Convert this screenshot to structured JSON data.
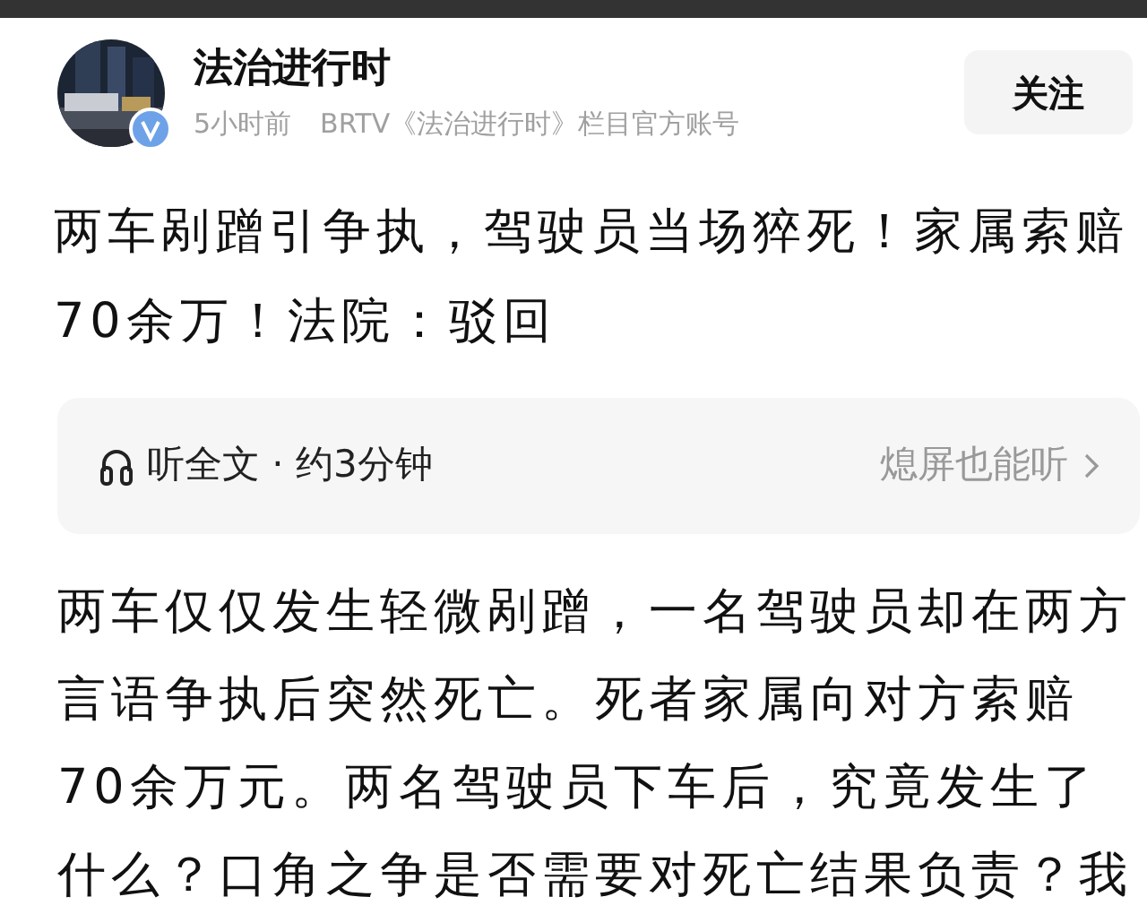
{
  "account": {
    "name": "法治进行时",
    "verified": true,
    "time": "5小时前",
    "description": "BRTV《法治进行时》栏目官方账号"
  },
  "follow_button": "关注",
  "headline": "两车剐蹭引争执，驾驶员当场猝死！家属索赔70余万！法院：驳回",
  "audio": {
    "label": "听全文 · 约3分钟",
    "action": "熄屏也能听"
  },
  "body": "两车仅仅发生轻微剐蹭，一名驾驶员却在两方言语争执后突然死亡。死者家属向对方索赔70余万元。两名驾驶员下车后，究竟发生了什么？口角之争是否需要对死亡结果负责？我"
}
